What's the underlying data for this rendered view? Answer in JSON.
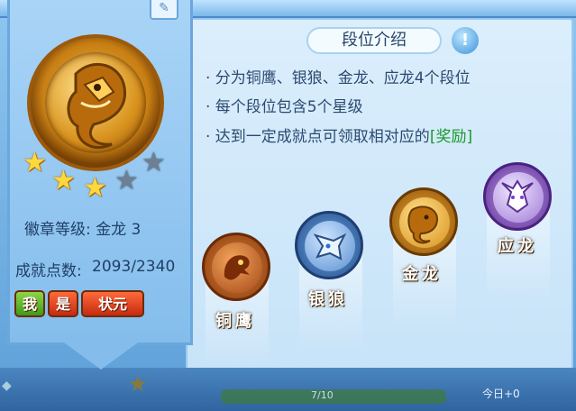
{
  "left_card": {
    "badge_level_label": "徽章等级: 金龙 3",
    "achievement_label": "成就点数:",
    "achievement_value": "2093/2340",
    "stars_earned": 3,
    "stars_total": 5,
    "tags": [
      "我",
      "是",
      "状元"
    ]
  },
  "panel": {
    "title": "段位介绍",
    "info_icon": "!",
    "lines": [
      "· 分为铜鹰、银狼、金龙、应龙4个段位",
      "· 每个段位包含5个星级",
      "· 达到一定成就点可领取相对应的"
    ],
    "reward_link": "[奖励]"
  },
  "ranks": [
    {
      "name": "铜鹰",
      "icon": "copper-eagle-icon"
    },
    {
      "name": "银狼",
      "icon": "silver-wolf-icon"
    },
    {
      "name": "金龙",
      "icon": "gold-dragon-icon"
    },
    {
      "name": "应龙",
      "icon": "winged-dragon-icon"
    }
  ],
  "bottom": {
    "progress_text": "7/10",
    "right_text": "今日+0"
  },
  "colors": {
    "gold": "#ffd83a",
    "reward_green": "#1a9a2a",
    "panel_text": "#2b4a70"
  }
}
